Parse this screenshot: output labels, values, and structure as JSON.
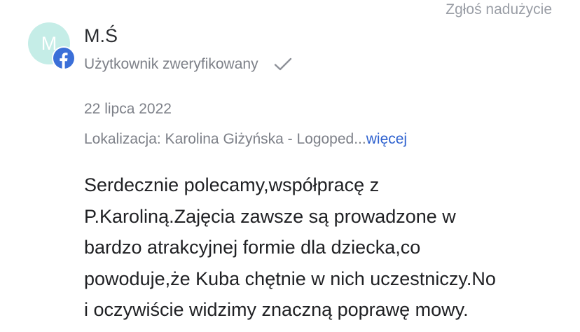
{
  "report_label": "Zgłoś nadużycie",
  "author": {
    "initial": "M",
    "name": "M.Ś",
    "badge": "verified-check-icon",
    "verified_label": "Użytkownik zweryfikowany",
    "source_icon": "facebook-icon"
  },
  "review": {
    "date": "22 lipca 2022",
    "location_prefix": "Lokalizacja: Karolina Giżyńska - Logoped...",
    "more_label": "więcej",
    "text_lines": [
      "Serdecznie polecamy,współpracę z",
      "P.Karoliną.Zajęcia zawsze są prowadzone w",
      "bardzo atrakcyjnej formie dla dziecka,co",
      "powoduje,że Kuba chętnie w nich uczestniczy.No",
      "i oczywiście widzimy znaczną poprawę mowy."
    ]
  },
  "colors": {
    "avatar_bg": "#c5ede7",
    "facebook_blue": "#3b6fd8",
    "link_blue": "#2f62cf",
    "muted_text": "#7d8088"
  }
}
